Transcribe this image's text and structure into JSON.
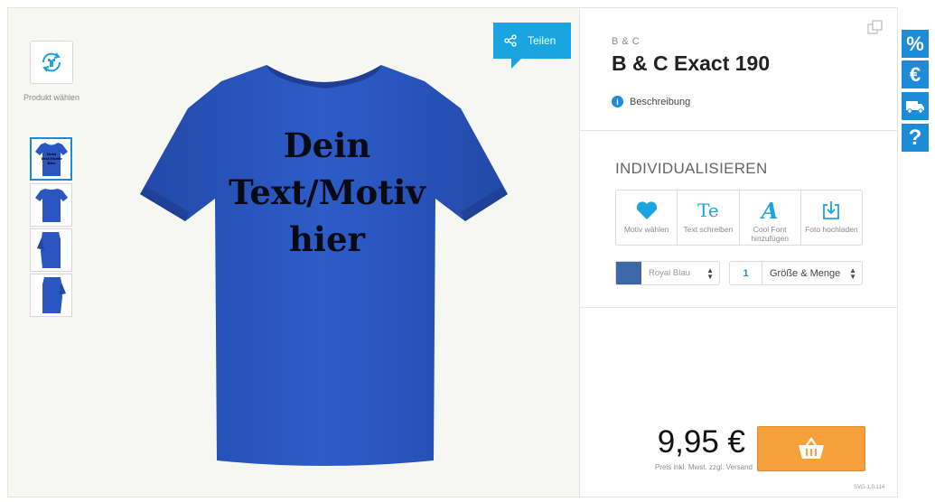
{
  "left": {
    "product_select_label": "Produkt wählen"
  },
  "share": {
    "label": "Teilen"
  },
  "shirt": {
    "color": "#2b56c2",
    "print_lines": [
      "Dein",
      "Text/Motiv",
      "hier"
    ]
  },
  "product": {
    "brand": "B & C",
    "title": "B & C Exact 190",
    "description_link": "Beschreibung"
  },
  "customize": {
    "section_title": "INDIVIDUALISIEREN",
    "tools": [
      {
        "icon": "heart-icon",
        "label": "Motiv wählen"
      },
      {
        "icon": "text-icon",
        "label": "Text schreiben",
        "glyph": "Te"
      },
      {
        "icon": "cool-font-icon",
        "label": "Cool Font hinzufügen",
        "glyph": "A"
      },
      {
        "icon": "upload-icon",
        "label": "Foto hochladen"
      }
    ],
    "color_select": {
      "value": "Royal Blau",
      "swatch": "#3d67a8"
    },
    "size_select": {
      "quantity": "1",
      "label": "Größe & Menge"
    }
  },
  "price": {
    "value": "9,95 €",
    "note": "Preis inkl. Mwst. zzgl. Versand"
  },
  "version": "SVG-1.0.114",
  "side_tabs": [
    {
      "icon": "percent-icon",
      "glyph": "%"
    },
    {
      "icon": "euro-icon",
      "glyph": "€"
    },
    {
      "icon": "truck-icon",
      "glyph": ""
    },
    {
      "icon": "help-icon",
      "glyph": "?"
    }
  ],
  "colors": {
    "accent_blue": "#1aa5e0",
    "cart_orange": "#f7a13d"
  }
}
